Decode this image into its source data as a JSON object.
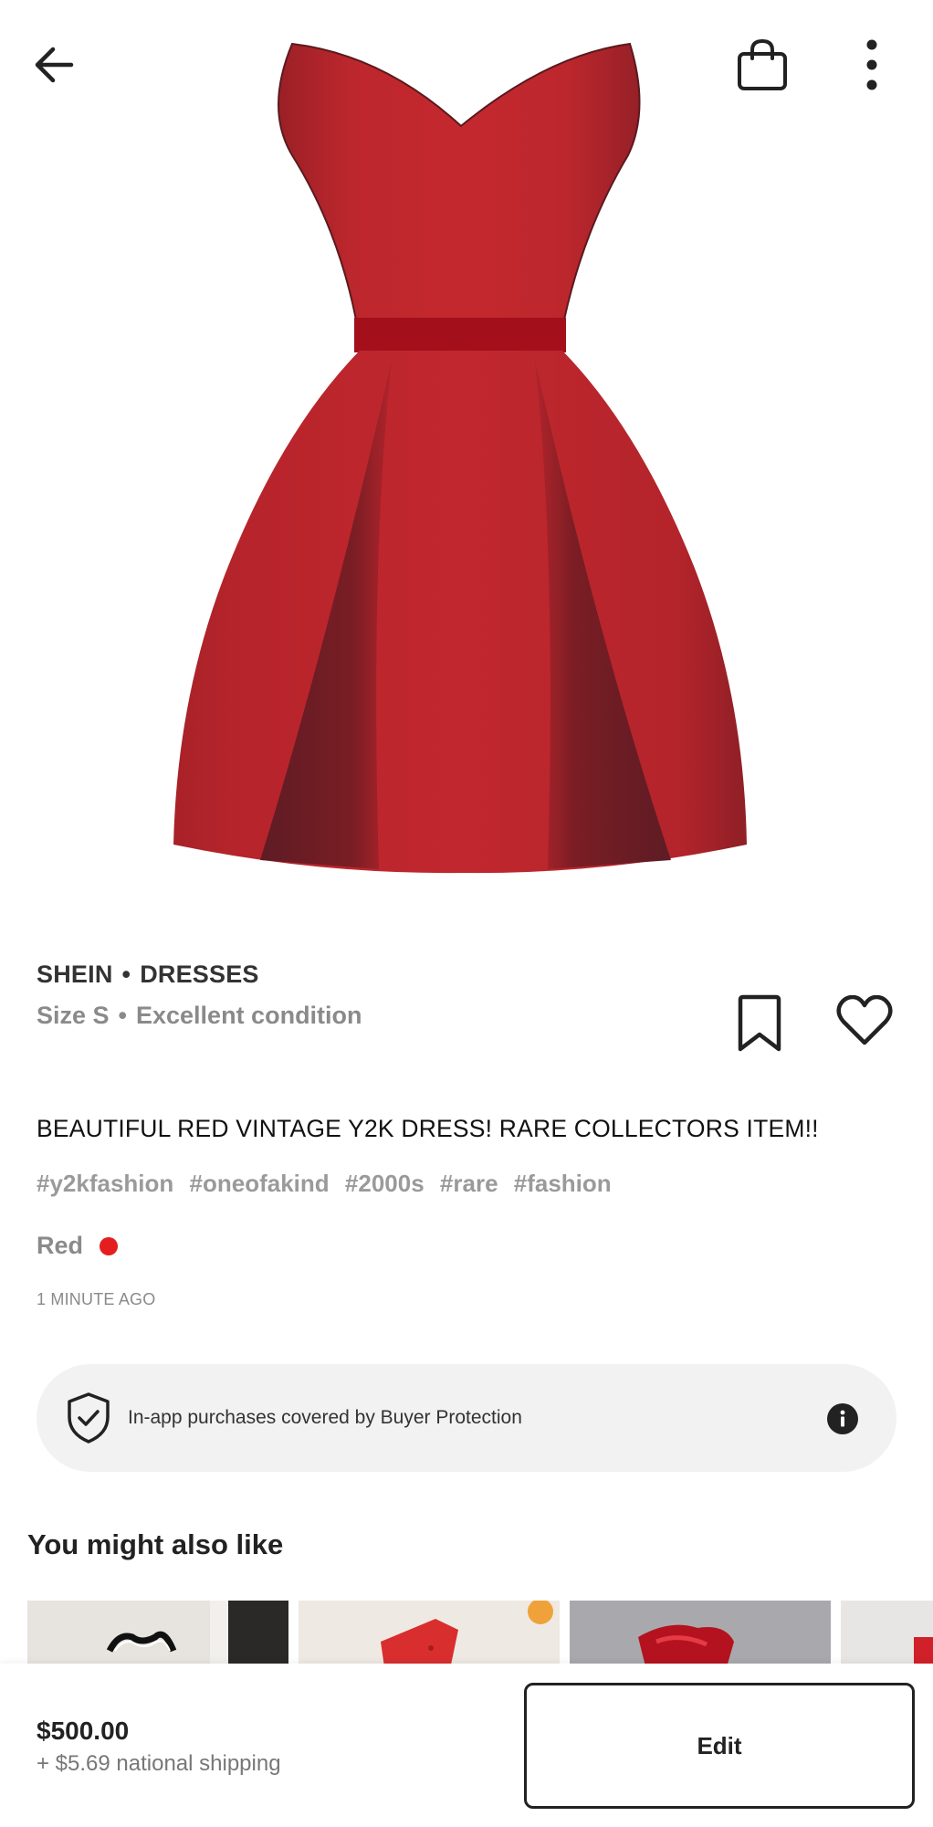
{
  "product": {
    "brand": "SHEIN",
    "category": "DRESSES",
    "size": "Size S",
    "condition": "Excellent condition",
    "title": "BEAUTIFUL RED VINTAGE Y2K DRESS! RARE COLLECTORS ITEM!!",
    "hashtags": [
      "#y2kfashion",
      "#oneofakind",
      "#2000s",
      "#rare",
      "#fashion"
    ],
    "color_name": "Red",
    "color_hex": "#e41e1e",
    "posted": "1 MINUTE AGO",
    "separator": "•"
  },
  "protection": {
    "text": "In-app purchases covered by Buyer Protection"
  },
  "recommendations": {
    "title": "You might also like"
  },
  "footer": {
    "price": "$500.00",
    "shipping": "+ $5.69 national shipping",
    "edit_label": "Edit"
  },
  "icons": {
    "back": "arrow-left",
    "bag": "shopping-bag",
    "more": "vertical-ellipsis",
    "bookmark": "bookmark-outline",
    "heart": "heart-outline",
    "shield": "shield-check",
    "info": "info-circle"
  },
  "colors": {
    "dress_red": "#c1272d",
    "sash_red": "#a3101b",
    "text_gray": "#8a8a8a"
  }
}
